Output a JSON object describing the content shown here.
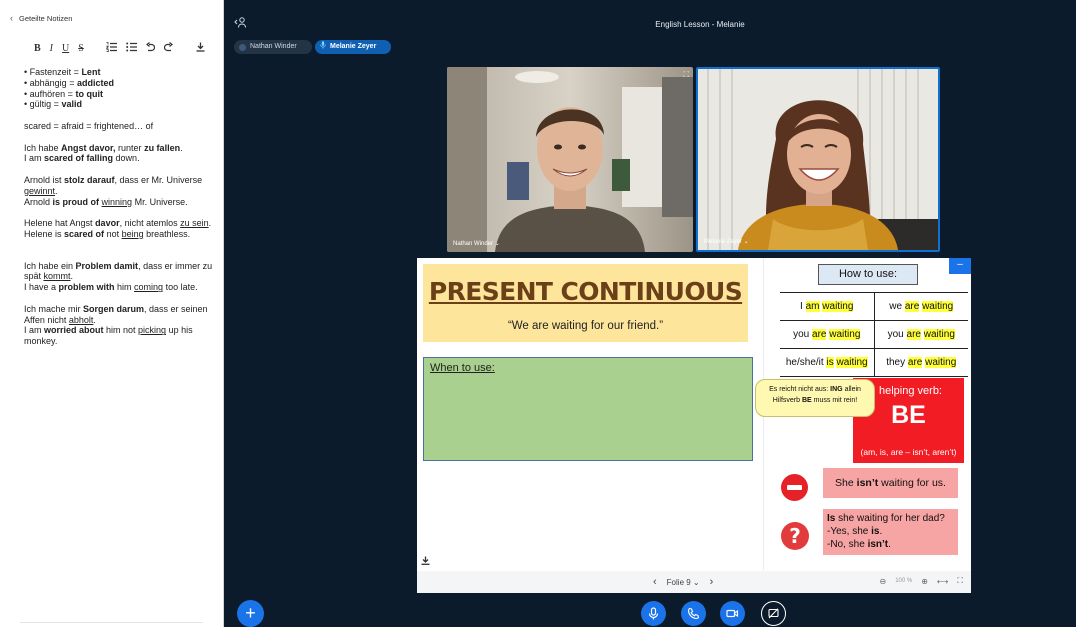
{
  "notes": {
    "header": "Geteilte Notizen",
    "toolbar": {
      "bold": "B",
      "italic": "I",
      "underline": "U",
      "strike": "S"
    },
    "lines": {
      "l1a": "• Fastenzeit = ",
      "l1b": "Lent",
      "l2a": "• abhängig = ",
      "l2b": "addicted",
      "l3a": "• aufhören = ",
      "l3b": "to quit",
      "l4a": "• gültig = ",
      "l4b": "valid",
      "p1": "scared = afraid = frightened… of",
      "p2a": "Ich habe ",
      "p2b": "Angst davor,",
      "p2c": " runter ",
      "p2d": "zu fallen",
      "p2e": ".",
      "p2f": "I am ",
      "p2g": "scared of falling",
      "p2h": " down.",
      "p3a": "Arnold ist ",
      "p3b": "stolz darauf",
      "p3c": ", dass er Mr. Universe ",
      "p3d": "gewinnt",
      "p3e": ".",
      "p3f": "Arnold ",
      "p3g": "is proud of",
      "p3h": " ",
      "p3i": "winning",
      "p3j": " Mr. Universe.",
      "p4a": "Helene hat Angst ",
      "p4b": "davor",
      "p4c": ", nicht atemlos ",
      "p4d": "zu sein",
      "p4e": ".",
      "p4f": "Helene is ",
      "p4g": "scared of",
      "p4h": " not ",
      "p4i": "being",
      "p4j": " breathless.",
      "p5a": "Ich habe ein ",
      "p5b": "Problem damit",
      "p5c": ", dass er immer zu spät ",
      "p5d": "kommt",
      "p5e": ".",
      "p5f": "I have a ",
      "p5g": "problem with",
      "p5h": " him ",
      "p5i": "coming",
      "p5j": " too late.",
      "p6a": "Ich mache mir ",
      "p6b": "Sorgen darum",
      "p6c": ", dass er seinen Affen nicht ",
      "p6d": "abholt",
      "p6e": ".",
      "p6f": "I am ",
      "p6g": "worried about",
      "p6h": " him not ",
      "p6i": "picking",
      "p6j": " up his monkey."
    }
  },
  "meeting": {
    "title": "English Lesson - Melanie",
    "participants": [
      "Nathan Winder",
      "Melanie Zeyer"
    ],
    "video_labels": [
      "Nathan Winder",
      "Melanie Zeyer"
    ]
  },
  "slide": {
    "title": "PRESENT CONTINUOUS",
    "subtitle": "“We are waiting for our friend.”",
    "when_label": "When to use:",
    "how_label": "How to use:",
    "conj": {
      "r1l_a": "I ",
      "r1l_b": "am",
      "r1l_c": " ",
      "r1l_d": "waiting",
      "r1r_a": "we ",
      "r1r_b": "are",
      "r1r_c": " ",
      "r1r_d": "waiting",
      "r2l_a": "you ",
      "r2l_b": "are",
      "r2l_c": " ",
      "r2l_d": "waiting",
      "r2r_a": "you ",
      "r2r_b": "are",
      "r2r_c": " ",
      "r2r_d": "waiting",
      "r3l_a": "he/she/it ",
      "r3l_b": "is",
      "r3l_c": " ",
      "r3l_d": "waiting",
      "r3r_a": "they ",
      "r3r_b": "are",
      "r3r_c": " ",
      "r3r_d": "waiting"
    },
    "bubble": {
      "a": "Es reicht nicht aus: ",
      "b": "ING",
      "c": " allein",
      "d": "Hilfsverb ",
      "e": "BE",
      "f": " muss mit rein!"
    },
    "be": {
      "helping": "helping verb:",
      "big": "BE",
      "small": "(am, is, are – isn’t, aren’t)"
    },
    "neg": {
      "a": "She ",
      "b": "isn’t",
      "c": " waiting for us."
    },
    "question": {
      "a": "Is",
      "b": " she waiting for her dad?",
      "c": "-Yes, she ",
      "d": "is",
      "e": ".",
      "f": "-No, she ",
      "g": "isn’t",
      "h": "."
    },
    "footer": {
      "page": "Folie 9",
      "zoom": "100 %"
    }
  },
  "colors": {
    "accent": "#1a73e8",
    "background": "#0b1b2b"
  }
}
